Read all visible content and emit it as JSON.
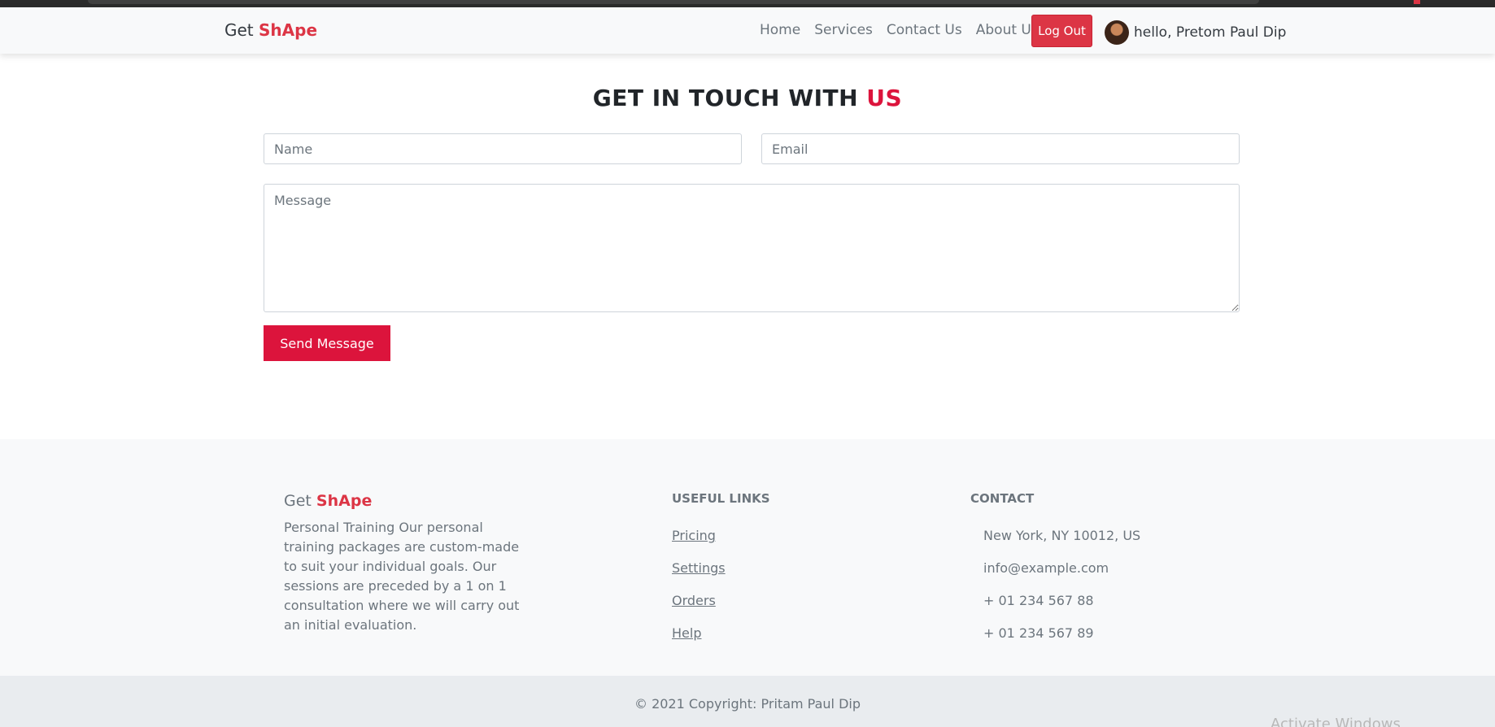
{
  "navbar": {
    "brand_prefix": "Get",
    "brand_accent": "ShApe",
    "links": [
      "Home",
      "Services",
      "Contact Us",
      "About Us"
    ],
    "logout_label": "Log Out",
    "greeting": "hello, Pretom Paul Dip"
  },
  "contact": {
    "title_prefix": "GET IN TOUCH WITH",
    "title_accent": "US",
    "name_placeholder": "Name",
    "email_placeholder": "Email",
    "message_placeholder": "Message",
    "send_label": "Send Message"
  },
  "footer": {
    "brand_prefix": "Get",
    "brand_accent": "ShApe",
    "description": "Personal Training Our personal training packages are custom-made to suit your individual goals. Our sessions are preceded by a 1 on 1 consultation where we will carry out an initial evaluation.",
    "links_heading": "USEFUL LINKS",
    "links": [
      "Pricing",
      "Settings",
      "Orders",
      "Help"
    ],
    "contact_heading": "CONTACT",
    "contacts": [
      "New York, NY 10012, US",
      "info@example.com",
      "+ 01 234 567 88",
      "+ 01 234 567 89"
    ],
    "copyright": "© 2021 Copyright: Pritam Paul Dip"
  },
  "watermark": "Activate Windows",
  "colors": {
    "accent": "#dc3545",
    "button": "#dc143c",
    "navbar_bg": "#f8f9fa",
    "footer_bg": "#f8f9fa",
    "copyright_bg": "#e9ecef"
  },
  "icons": {
    "avatar": "user-avatar"
  }
}
